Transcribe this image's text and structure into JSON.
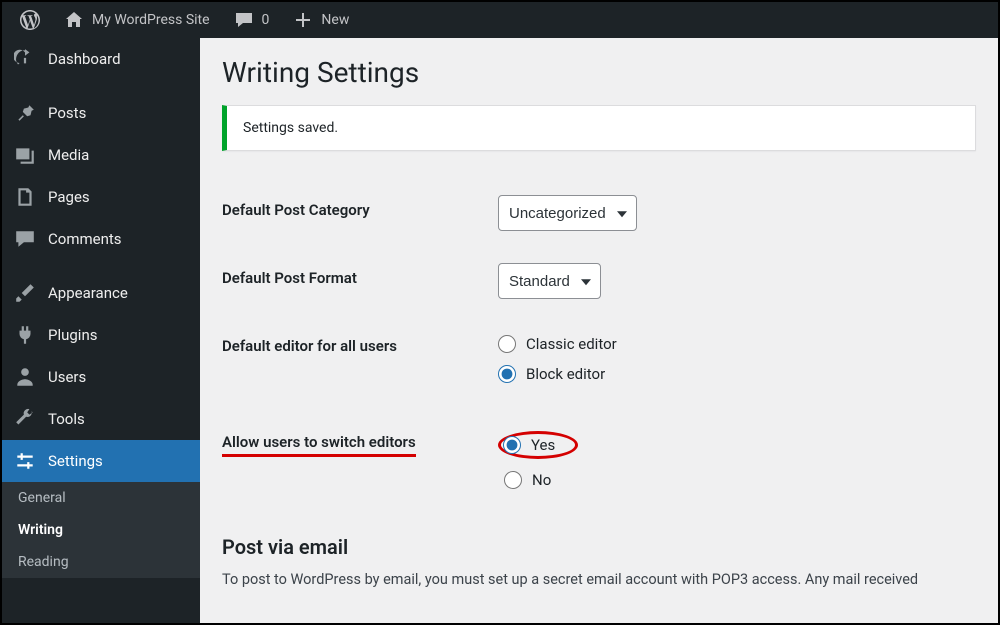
{
  "adminbar": {
    "site_name": "My WordPress Site",
    "comments_count": "0",
    "new_label": "New"
  },
  "sidebar": {
    "items": [
      {
        "label": "Dashboard"
      },
      {
        "label": "Posts"
      },
      {
        "label": "Media"
      },
      {
        "label": "Pages"
      },
      {
        "label": "Comments"
      },
      {
        "label": "Appearance"
      },
      {
        "label": "Plugins"
      },
      {
        "label": "Users"
      },
      {
        "label": "Tools"
      },
      {
        "label": "Settings"
      }
    ],
    "submenu": [
      {
        "label": "General"
      },
      {
        "label": "Writing"
      },
      {
        "label": "Reading"
      }
    ]
  },
  "page": {
    "title": "Writing Settings",
    "notice": "Settings saved.",
    "fields": {
      "default_post_category_label": "Default Post Category",
      "default_post_category_value": "Uncategorized",
      "default_post_format_label": "Default Post Format",
      "default_post_format_value": "Standard",
      "default_editor_label": "Default editor for all users",
      "editor_classic": "Classic editor",
      "editor_block": "Block editor",
      "allow_switch_label": "Allow users to switch editors",
      "switch_yes": "Yes",
      "switch_no": "No"
    },
    "email_section_title": "Post via email",
    "email_section_desc": "To post to WordPress by email, you must set up a secret email account with POP3 access. Any mail received"
  }
}
